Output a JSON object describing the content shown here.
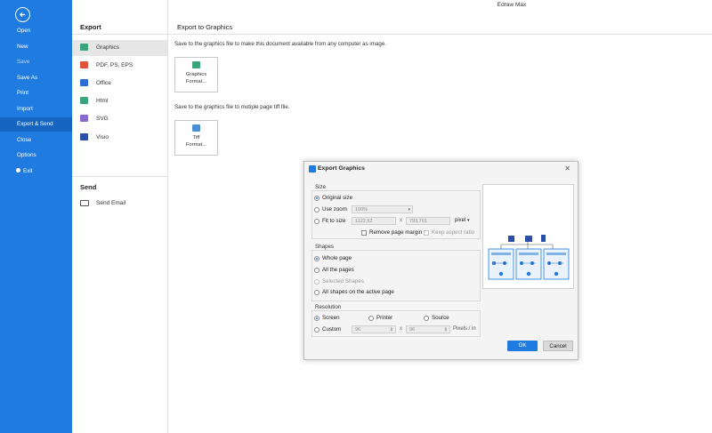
{
  "app": {
    "title": "Edraw Max"
  },
  "sidebar": {
    "items": [
      {
        "label": "Open"
      },
      {
        "label": "New"
      },
      {
        "label": "Save"
      },
      {
        "label": "Save As"
      },
      {
        "label": "Print"
      },
      {
        "label": "Import"
      },
      {
        "label": "Export & Send"
      },
      {
        "label": "Close"
      },
      {
        "label": "Options"
      },
      {
        "label": "Exit"
      }
    ],
    "active": "Export & Send",
    "colors": {
      "bg": "#1f7be0",
      "active_bg": "#1565c0"
    }
  },
  "middle": {
    "export_header": "Export",
    "export_items": [
      {
        "label": "Graphics",
        "icon": "graphics-icon",
        "color": "#3aa57a"
      },
      {
        "label": "PDF, PS, EPS",
        "icon": "pdf-icon",
        "color": "#e0533d"
      },
      {
        "label": "Office",
        "icon": "office-icon",
        "color": "#2b6fd6"
      },
      {
        "label": "Html",
        "icon": "html-icon",
        "color": "#3aa57a"
      },
      {
        "label": "SVG",
        "icon": "svg-icon",
        "color": "#8a6ad1"
      },
      {
        "label": "Visio",
        "icon": "visio-icon",
        "color": "#2b4fa8"
      }
    ],
    "send_header": "Send",
    "send_items": [
      {
        "label": "Send Email",
        "icon": "email-icon"
      }
    ]
  },
  "content": {
    "title": "Export to Graphics",
    "desc1": "Save to the graphics file to make this document available from any computer as image.",
    "card1": {
      "line1": "Graphics",
      "line2": "Format...",
      "icon_label": "JPG"
    },
    "desc2": "Save to the graphics file to mutiple page tiff file.",
    "card2": {
      "line1": "Tiff",
      "line2": "Format...",
      "icon_label": "TIFF"
    }
  },
  "dialog": {
    "title": "Export Graphics",
    "size": {
      "title": "Size",
      "original": "Original size",
      "use_zoom": "Use zoom",
      "zoom_value": "100%",
      "fit_to_size": "Fit to size",
      "width": "1122,52",
      "times": "x",
      "height": "793,701",
      "unit": "pixel",
      "remove_margin": "Remove page margin",
      "keep_ratio": "Keep aspect ratio"
    },
    "shapes": {
      "title": "Shapes",
      "whole_page": "Whole page",
      "all_pages": "All the pages",
      "selected": "Selected Shapes",
      "active_page": "All shapes on the active page"
    },
    "resolution": {
      "title": "Resolution",
      "screen": "Screen",
      "printer": "Printer",
      "source": "Source",
      "custom": "Custom",
      "x_value": "96",
      "times": "x",
      "y_value": "96",
      "unit": "Pixels / in"
    },
    "ok": "OK",
    "cancel": "Cancel"
  }
}
